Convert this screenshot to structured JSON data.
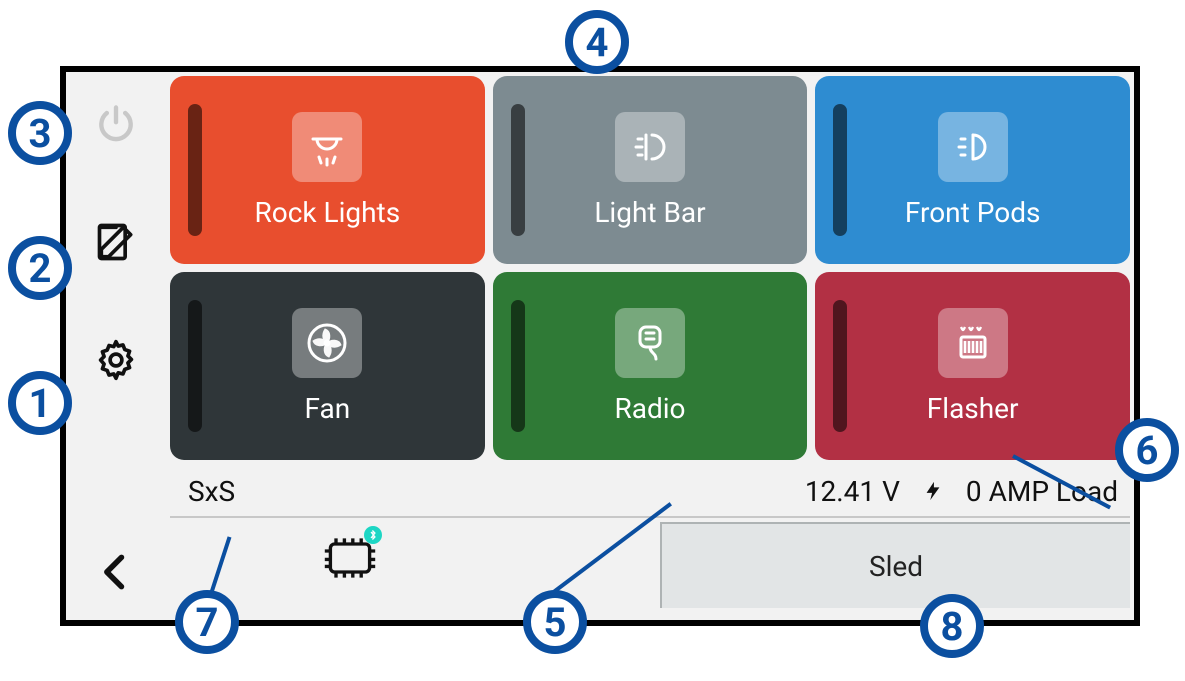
{
  "sidebar": {
    "power_name": "power-icon",
    "edit_name": "edit-icon",
    "settings_name": "gear-icon",
    "back_name": "chevron-left-icon"
  },
  "tiles": [
    {
      "label": "Rock Lights",
      "color": "c-orange",
      "icon": "rock-lights-icon"
    },
    {
      "label": "Light Bar",
      "color": "c-grayblue",
      "icon": "light-bar-icon"
    },
    {
      "label": "Front Pods",
      "color": "c-blue",
      "icon": "front-pods-icon"
    },
    {
      "label": "Fan",
      "color": "c-dark",
      "icon": "fan-icon"
    },
    {
      "label": "Radio",
      "color": "c-green",
      "icon": "radio-icon"
    },
    {
      "label": "Flasher",
      "color": "c-red",
      "icon": "flasher-icon"
    }
  ],
  "status": {
    "profile": "SxS",
    "voltage": "12.41 V",
    "load": "0 AMP Load"
  },
  "tab": {
    "label": "Sled"
  },
  "callouts": {
    "1": "1",
    "2": "2",
    "3": "3",
    "4": "4",
    "5": "5",
    "6": "6",
    "7": "7",
    "8": "8"
  }
}
